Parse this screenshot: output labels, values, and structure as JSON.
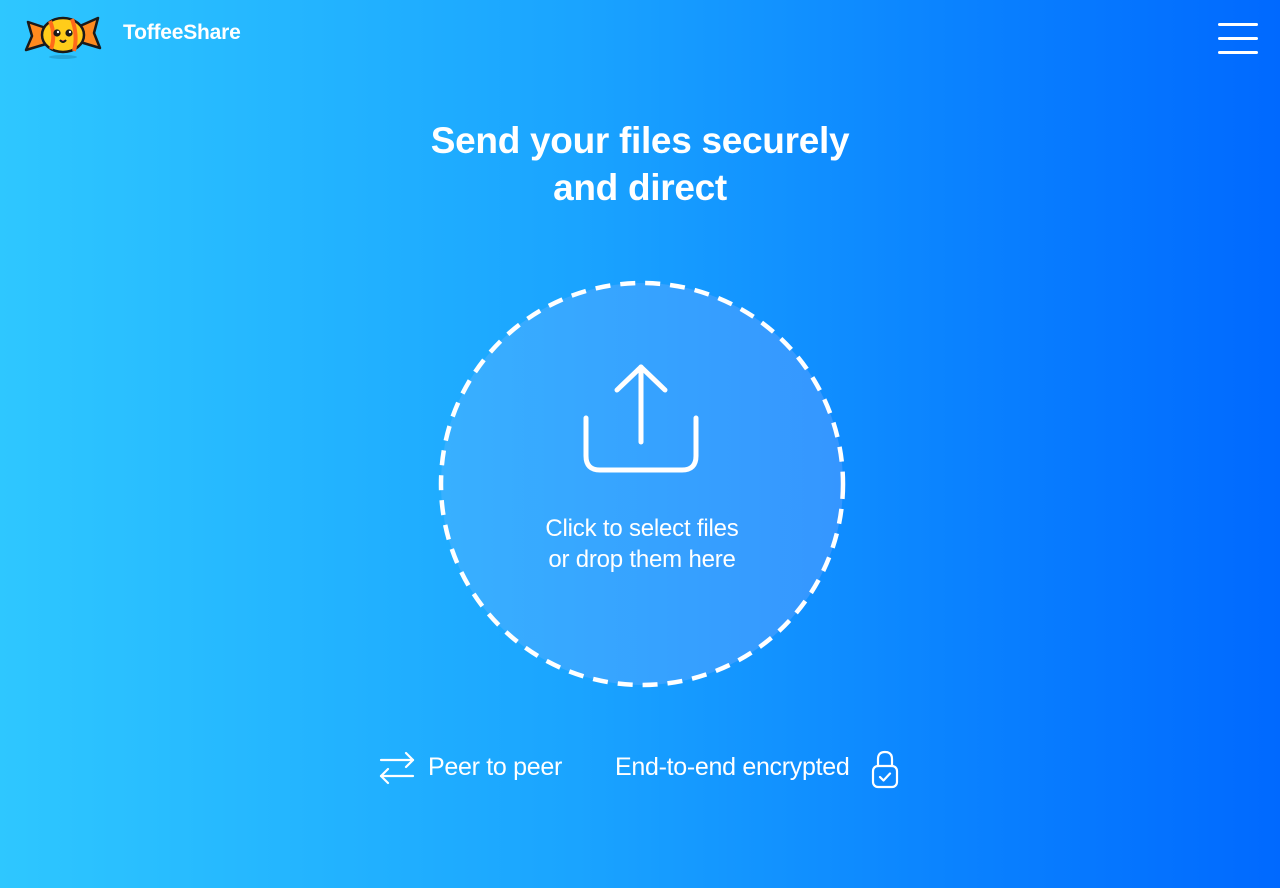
{
  "header": {
    "brand": "ToffeeShare",
    "logo_icon": "candy-mascot-icon",
    "menu_icon": "hamburger-menu-icon"
  },
  "hero": {
    "title_line1": "Send your files securely",
    "title_line2": "and direct"
  },
  "dropzone": {
    "icon": "upload-icon",
    "text": "Click to select files or drop them here"
  },
  "features": [
    {
      "icon": "swap-arrows-icon",
      "label": "Peer to peer"
    },
    {
      "icon": "lock-check-icon",
      "label": "End-to-end encrypted"
    }
  ],
  "colors": {
    "gradient_left": "#2ec7ff",
    "gradient_right": "#0069ff",
    "dropzone_fill": "#3aa6ff",
    "foreground": "#ffffff"
  }
}
